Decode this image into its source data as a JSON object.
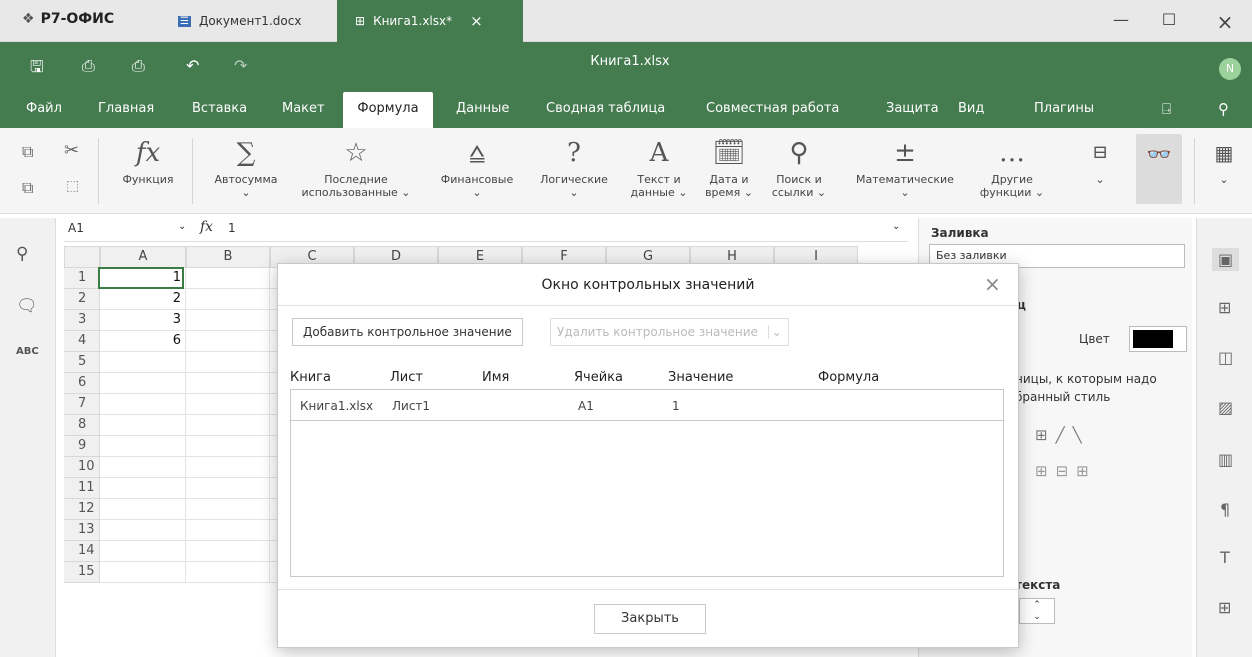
{
  "titlebar": {
    "app_name": "Р7-ОФИС",
    "tabs": [
      {
        "label": "Документ1.docx",
        "icon": "document-icon"
      },
      {
        "label": "Книга1.xlsx*",
        "icon": "spreadsheet-icon"
      }
    ],
    "tab_close": "×",
    "minimize": "—",
    "maximize": "☐",
    "close": "×"
  },
  "header": {
    "doc_title": "Книга1.xlsx",
    "avatar": "N"
  },
  "menu": [
    "Файл",
    "Главная",
    "Вставка",
    "Макет",
    "Формула",
    "Данные",
    "Сводная таблица",
    "Совместная работа",
    "Защита",
    "Вид",
    "Плагины"
  ],
  "ribbon": {
    "function": "Функция",
    "autosum": "Автосумма",
    "recent": [
      "Последние",
      "использованные ⌄"
    ],
    "financial": "Финансовые",
    "logical": "Логические",
    "text_data": [
      "Текст и",
      "данные ⌄"
    ],
    "date_time": [
      "Дата и",
      "время ⌄"
    ],
    "lookup": [
      "Поиск и",
      "ссылки ⌄"
    ],
    "math": "Математические",
    "other": [
      "Другие",
      "функции ⌄"
    ],
    "chev": "⌄"
  },
  "formula_bar": {
    "cell_ref": "A1",
    "fx": "fx",
    "value": "1"
  },
  "grid": {
    "columns": [
      "A",
      "B",
      "C",
      "D",
      "E",
      "F",
      "G",
      "H",
      "I"
    ],
    "rows": [
      "1",
      "2",
      "3",
      "4",
      "5",
      "6",
      "7",
      "8",
      "9",
      "10",
      "11",
      "12",
      "13",
      "14",
      "15"
    ],
    "a_values": [
      "1",
      "2",
      "3",
      "6"
    ]
  },
  "right_panel": {
    "fill_label": "Заливка",
    "fill_value": "Без заливки",
    "border_head": "ц",
    "color_label": "Цвет",
    "color_value": "#000000",
    "desc1": "ницы, к которым надо",
    "desc2": "бранный стиль",
    "text_label": "текста"
  },
  "dialog": {
    "title": "Окно контрольных значений",
    "add_button": "Добавить контрольное значение",
    "delete_button": "Удалить контрольное значение",
    "headers": [
      "Книга",
      "Лист",
      "Имя",
      "Ячейка",
      "Значение",
      "Формула"
    ],
    "row": {
      "book": "Книга1.xlsx",
      "sheet": "Лист1",
      "name": "",
      "cell": "A1",
      "value": "1",
      "formula": ""
    },
    "close_button": "Закрыть",
    "close_x": "×"
  },
  "colors": {
    "accent": "#447b4f",
    "selection": "#3a7d44"
  }
}
